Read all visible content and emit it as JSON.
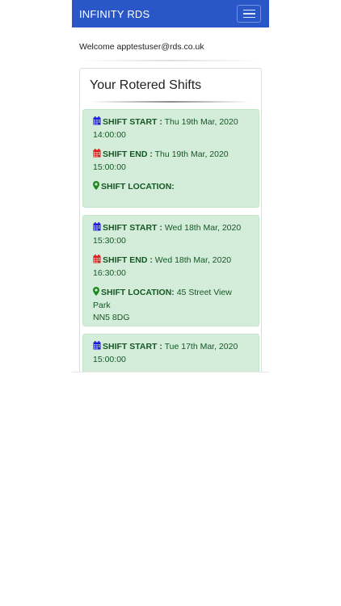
{
  "navbar": {
    "brand": "INFINITY RDS"
  },
  "welcome_text": "Welcome apptestuser@rds.co.uk",
  "card": {
    "title": "Your Rotered Shifts"
  },
  "labels": {
    "start": "SHIFT START :",
    "end": "SHIFT END :",
    "location": "SHIFT LOCATION:"
  },
  "shifts": [
    {
      "start_date": "Thu 19th Mar, 2020",
      "start_time": "14:00:00",
      "end_date": "Thu 19th Mar, 2020",
      "end_time": "15:00:00",
      "location_line1": "",
      "location_line2": ""
    },
    {
      "start_date": "Wed 18th Mar, 2020",
      "start_time": "15:30:00",
      "end_date": "Wed 18th Mar, 2020",
      "end_time": "16:30:00",
      "location_line1": "45 Street View Park",
      "location_line2": "NN5 8DG"
    },
    {
      "start_date": "Tue 17th Mar, 2020",
      "start_time": "15:00:00"
    }
  ],
  "colors": {
    "navbar": "#2a57c8",
    "alert_bg": "#d4edda",
    "alert_text": "#155724",
    "calendar_start_icon": "#1a1ad8",
    "calendar_end_icon": "#e01b1b",
    "location_icon": "#1e8a1e"
  },
  "icons": {
    "start": "calendar-icon",
    "end": "calendar-icon",
    "location": "map-marker-icon"
  }
}
